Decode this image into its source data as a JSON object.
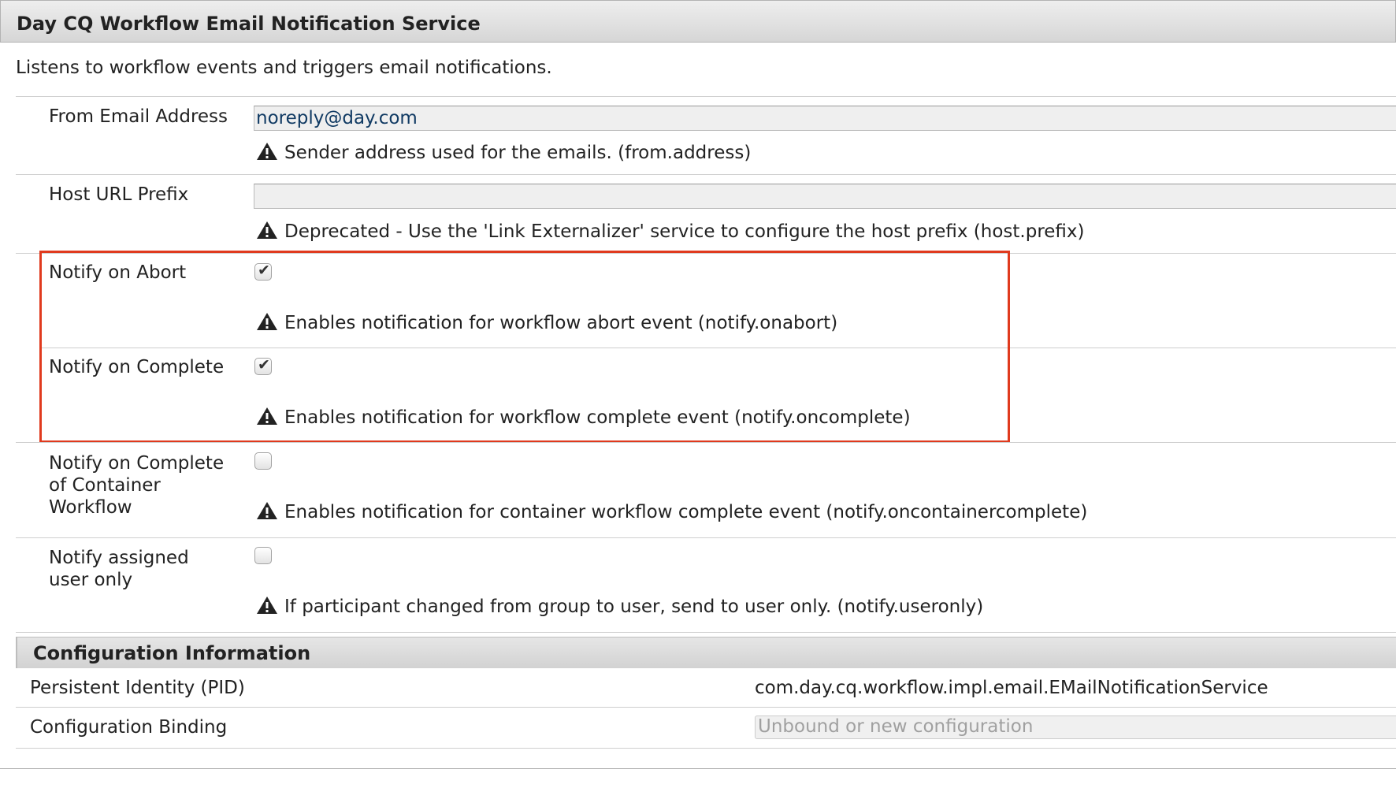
{
  "header": {
    "title": "Day CQ Workflow Email Notification Service"
  },
  "description": "Listens to workflow events and triggers email notifications.",
  "fields": {
    "from_address": {
      "label": "From Email Address",
      "value": "noreply@day.com",
      "hint": "Sender address used for the emails. (from.address)"
    },
    "host_prefix": {
      "label": "Host URL Prefix",
      "value": "",
      "hint": "Deprecated - Use the 'Link Externalizer' service to configure the host prefix (host.prefix)"
    },
    "notify_abort": {
      "label": "Notify on Abort",
      "checked": true,
      "hint": "Enables notification for workflow abort event (notify.onabort)"
    },
    "notify_complete": {
      "label": "Notify on Complete",
      "checked": true,
      "hint": "Enables notification for workflow complete event (notify.oncomplete)"
    },
    "notify_container": {
      "label_lines": [
        "Notify on Complete",
        "of Container",
        "Workflow"
      ],
      "checked": false,
      "hint": "Enables notification for container workflow complete event (notify.oncontainercomplete)"
    },
    "notify_useronly": {
      "label_lines": [
        "Notify assigned",
        "user only"
      ],
      "checked": false,
      "hint": "If participant changed from group to user, send to user only. (notify.useronly)"
    }
  },
  "config_info": {
    "title": "Configuration Information",
    "pid_label": "Persistent Identity (PID)",
    "pid_value": "com.day.cq.workflow.impl.email.EMailNotificationService",
    "binding_label": "Configuration Binding",
    "binding_value": "Unbound or new configuration"
  },
  "colors": {
    "highlight_border": "#e03a1e",
    "input_text": "#103a63"
  },
  "icons": {
    "hint": "warning-triangle-icon",
    "checkbox_mark": "checkmark-icon"
  }
}
